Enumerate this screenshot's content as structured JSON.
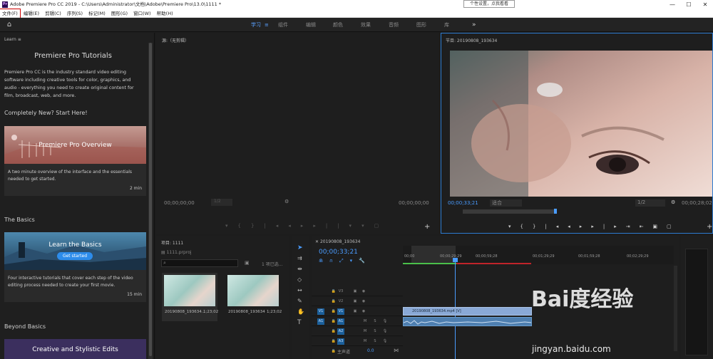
{
  "titlebar": {
    "title": "Adobe Premiere Pro CC 2019 - C:\\Users\\Administrator\\文档\\Adobe\\Premiere Pro\\13.0\\1111 *",
    "logo": "Pr",
    "tooltip": "个性设置，点我看看",
    "min": "—",
    "max": "☐",
    "close": "✕"
  },
  "menu": [
    "文件(F)",
    "编辑(E)",
    "剪辑(C)",
    "序列(S)",
    "标记(M)",
    "图形(G)",
    "窗口(W)",
    "帮助(H)"
  ],
  "workspaces": {
    "items": [
      "学习",
      "组件",
      "编辑",
      "颜色",
      "效果",
      "音频",
      "图形",
      "库"
    ],
    "active_index": 0,
    "more": "»",
    "menu_icon": "≡"
  },
  "learn": {
    "tab": "Learn",
    "title": "Premiere Pro Tutorials",
    "description": "Premiere Pro CC is the industry standard video editing software including creative tools for color, graphics, and audio - everything you need to create original content for film, broadcast, web, and more.",
    "section1": "Completely New? Start Here!",
    "card1": {
      "title": "Premiere Pro Overview",
      "text": "A two minute overview of the interface and the essentials needed to get started.",
      "duration": "2 min"
    },
    "section2": "The Basics",
    "card2": {
      "title": "Learn the Basics",
      "button": "Get started",
      "text": "Four interactive tutorials that cover each step of the video editing process needed to create your first movie.",
      "duration": "15 min"
    },
    "section3": "Beyond Basics",
    "card3": {
      "title": "Creative and Stylistic Edits"
    }
  },
  "source": {
    "tab": "源:（无剪辑）",
    "tc_left": "00;00;00;00",
    "tc_right": "00;00;00;00",
    "fit": "1/2"
  },
  "program": {
    "tab": "节目: 20190808_193634",
    "tc_left": "00;00;33;21",
    "fit": "适合",
    "res": "1/2",
    "tc_right": "00;00;28;02"
  },
  "project": {
    "tab": "项目: 1111",
    "file": "1111.prproj",
    "selected": "1 项已选...",
    "items": [
      {
        "name": "20190808_193634...",
        "dur": "1;23;02"
      },
      {
        "name": "20190808_193634",
        "dur": "1;23;02"
      }
    ]
  },
  "timeline": {
    "tab": "20190808_193634",
    "tc": "00;00;33;21",
    "ruler": [
      "00;00",
      "00;00;29;29",
      "00;00;59;28",
      "00;01;29;29",
      "00;01;59;28",
      "00;02;29;29"
    ],
    "tracks": [
      "V3",
      "V2",
      "V1",
      "A1",
      "A2",
      "A3"
    ],
    "master": "主声道",
    "master_val": "0.0",
    "clip": "20190808_193634.mp4 [V]"
  },
  "watermark": {
    "main": "Bai度经验",
    "sub": "jingyan.baidu.com"
  },
  "colors": {
    "accent": "#5aa1ff",
    "clip_video": "#8aa9d6",
    "clip_audio": "#4e7fb0"
  }
}
